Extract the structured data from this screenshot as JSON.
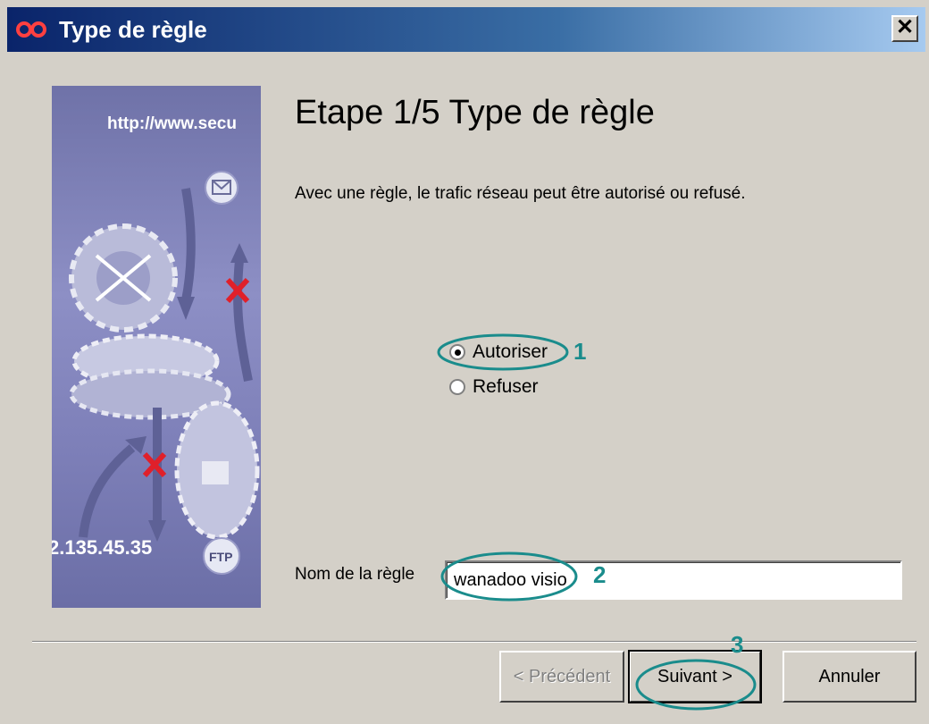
{
  "window": {
    "title": "Type de règle",
    "close_glyph": "✕"
  },
  "side_image": {
    "url_text": "http://www.secu",
    "ip_text": "2.135.45.35",
    "ftp_badge": "FTP",
    "icons": [
      "gears-icon",
      "mail-icon",
      "arrow-icon",
      "blocked-x-icon",
      "ftp-icon"
    ]
  },
  "step": {
    "heading": "Etape 1/5 Type de règle",
    "description": "Avec une règle, le trafic réseau peut être autorisé ou refusé."
  },
  "rule_type": {
    "options": [
      {
        "label": "Autoriser",
        "selected": true
      },
      {
        "label": "Refuser",
        "selected": false
      }
    ]
  },
  "rule_name": {
    "label": "Nom de la règle",
    "value": "wanadoo visio"
  },
  "buttons": {
    "previous": "< Précédent",
    "next": "Suivant >",
    "cancel": "Annuler"
  },
  "annotations": {
    "one": "1",
    "two": "2",
    "three": "3",
    "color": "#1a8c8c"
  },
  "colors": {
    "title_bar_start": "#0a246a",
    "dialog_background": "#d4d0c8",
    "side_panel": "#8d8fc5",
    "x_mark": "#e0202a"
  }
}
